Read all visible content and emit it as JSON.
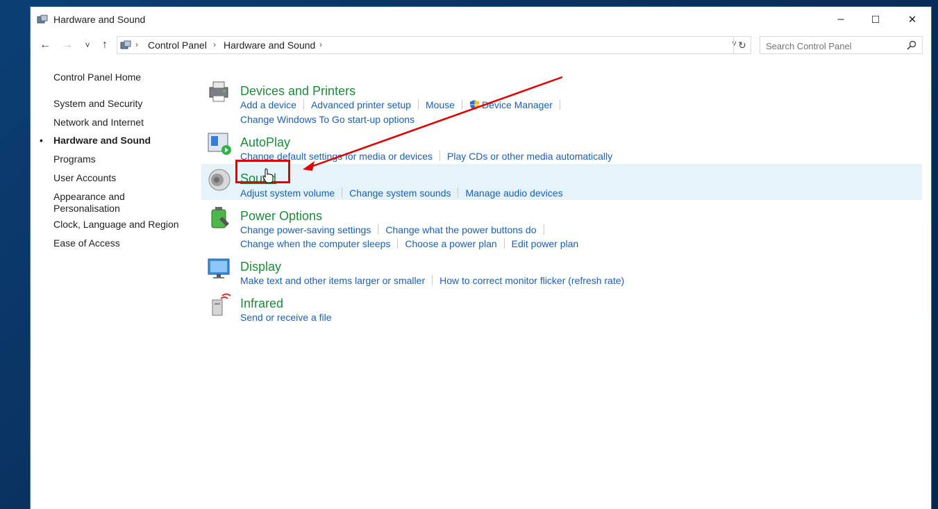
{
  "window": {
    "title": "Hardware and Sound"
  },
  "titlebar_buttons": {
    "minimize": "–",
    "maximize": "☐",
    "close": "✕"
  },
  "nav": {
    "back": "←",
    "forward": "→",
    "recent": "˅",
    "up": "↑",
    "breadcrumb": [
      "Control Panel",
      "Hardware and Sound"
    ],
    "dropdown": "˅",
    "refresh": "↻"
  },
  "search": {
    "placeholder": "Search Control Panel",
    "icon": "search-icon"
  },
  "leftnav": {
    "items": [
      {
        "label": "Control Panel Home"
      },
      {
        "label": "System and Security"
      },
      {
        "label": "Network and Internet"
      },
      {
        "label": "Hardware and Sound",
        "active": true
      },
      {
        "label": "Programs"
      },
      {
        "label": "User Accounts"
      },
      {
        "label": "Appearance and"
      },
      {
        "label": "Personalisation"
      },
      {
        "label": "Clock, Language and Region"
      },
      {
        "label": "Ease of Access"
      }
    ]
  },
  "categories": [
    {
      "title": "Devices and Printers",
      "icon": "printer-icon",
      "links_row1": [
        "Add a device",
        "Advanced printer setup",
        "Mouse",
        "Device Manager"
      ],
      "links_row2": [
        "Change Windows To Go start-up options"
      ]
    },
    {
      "title": "AutoPlay",
      "icon": "autoplay-icon",
      "links_row1": [
        "Change default settings for media or devices",
        "Play CDs or other media automatically"
      ]
    },
    {
      "title": "Sound",
      "icon": "speaker-icon",
      "links_row1": [
        "Adjust system volume",
        "Change system sounds",
        "Manage audio devices"
      ]
    },
    {
      "title": "Power Options",
      "icon": "battery-icon",
      "links_row1": [
        "Change power-saving settings",
        "Change what the power buttons do"
      ],
      "links_row2": [
        "Change when the computer sleeps",
        "Choose a power plan",
        "Edit power plan"
      ]
    },
    {
      "title": "Display",
      "icon": "monitor-icon",
      "links_row1": [
        "Make text and other items larger or smaller",
        "How to correct monitor flicker (refresh rate)"
      ]
    },
    {
      "title": "Infrared",
      "icon": "infrared-icon",
      "links_row1": [
        "Send or receive a file"
      ]
    }
  ],
  "colors": {
    "title_green": "#1e8a3a",
    "link_blue": "#1a5fb4",
    "highlight_row": "#e5f3fb",
    "annotation_red": "#e00000"
  }
}
